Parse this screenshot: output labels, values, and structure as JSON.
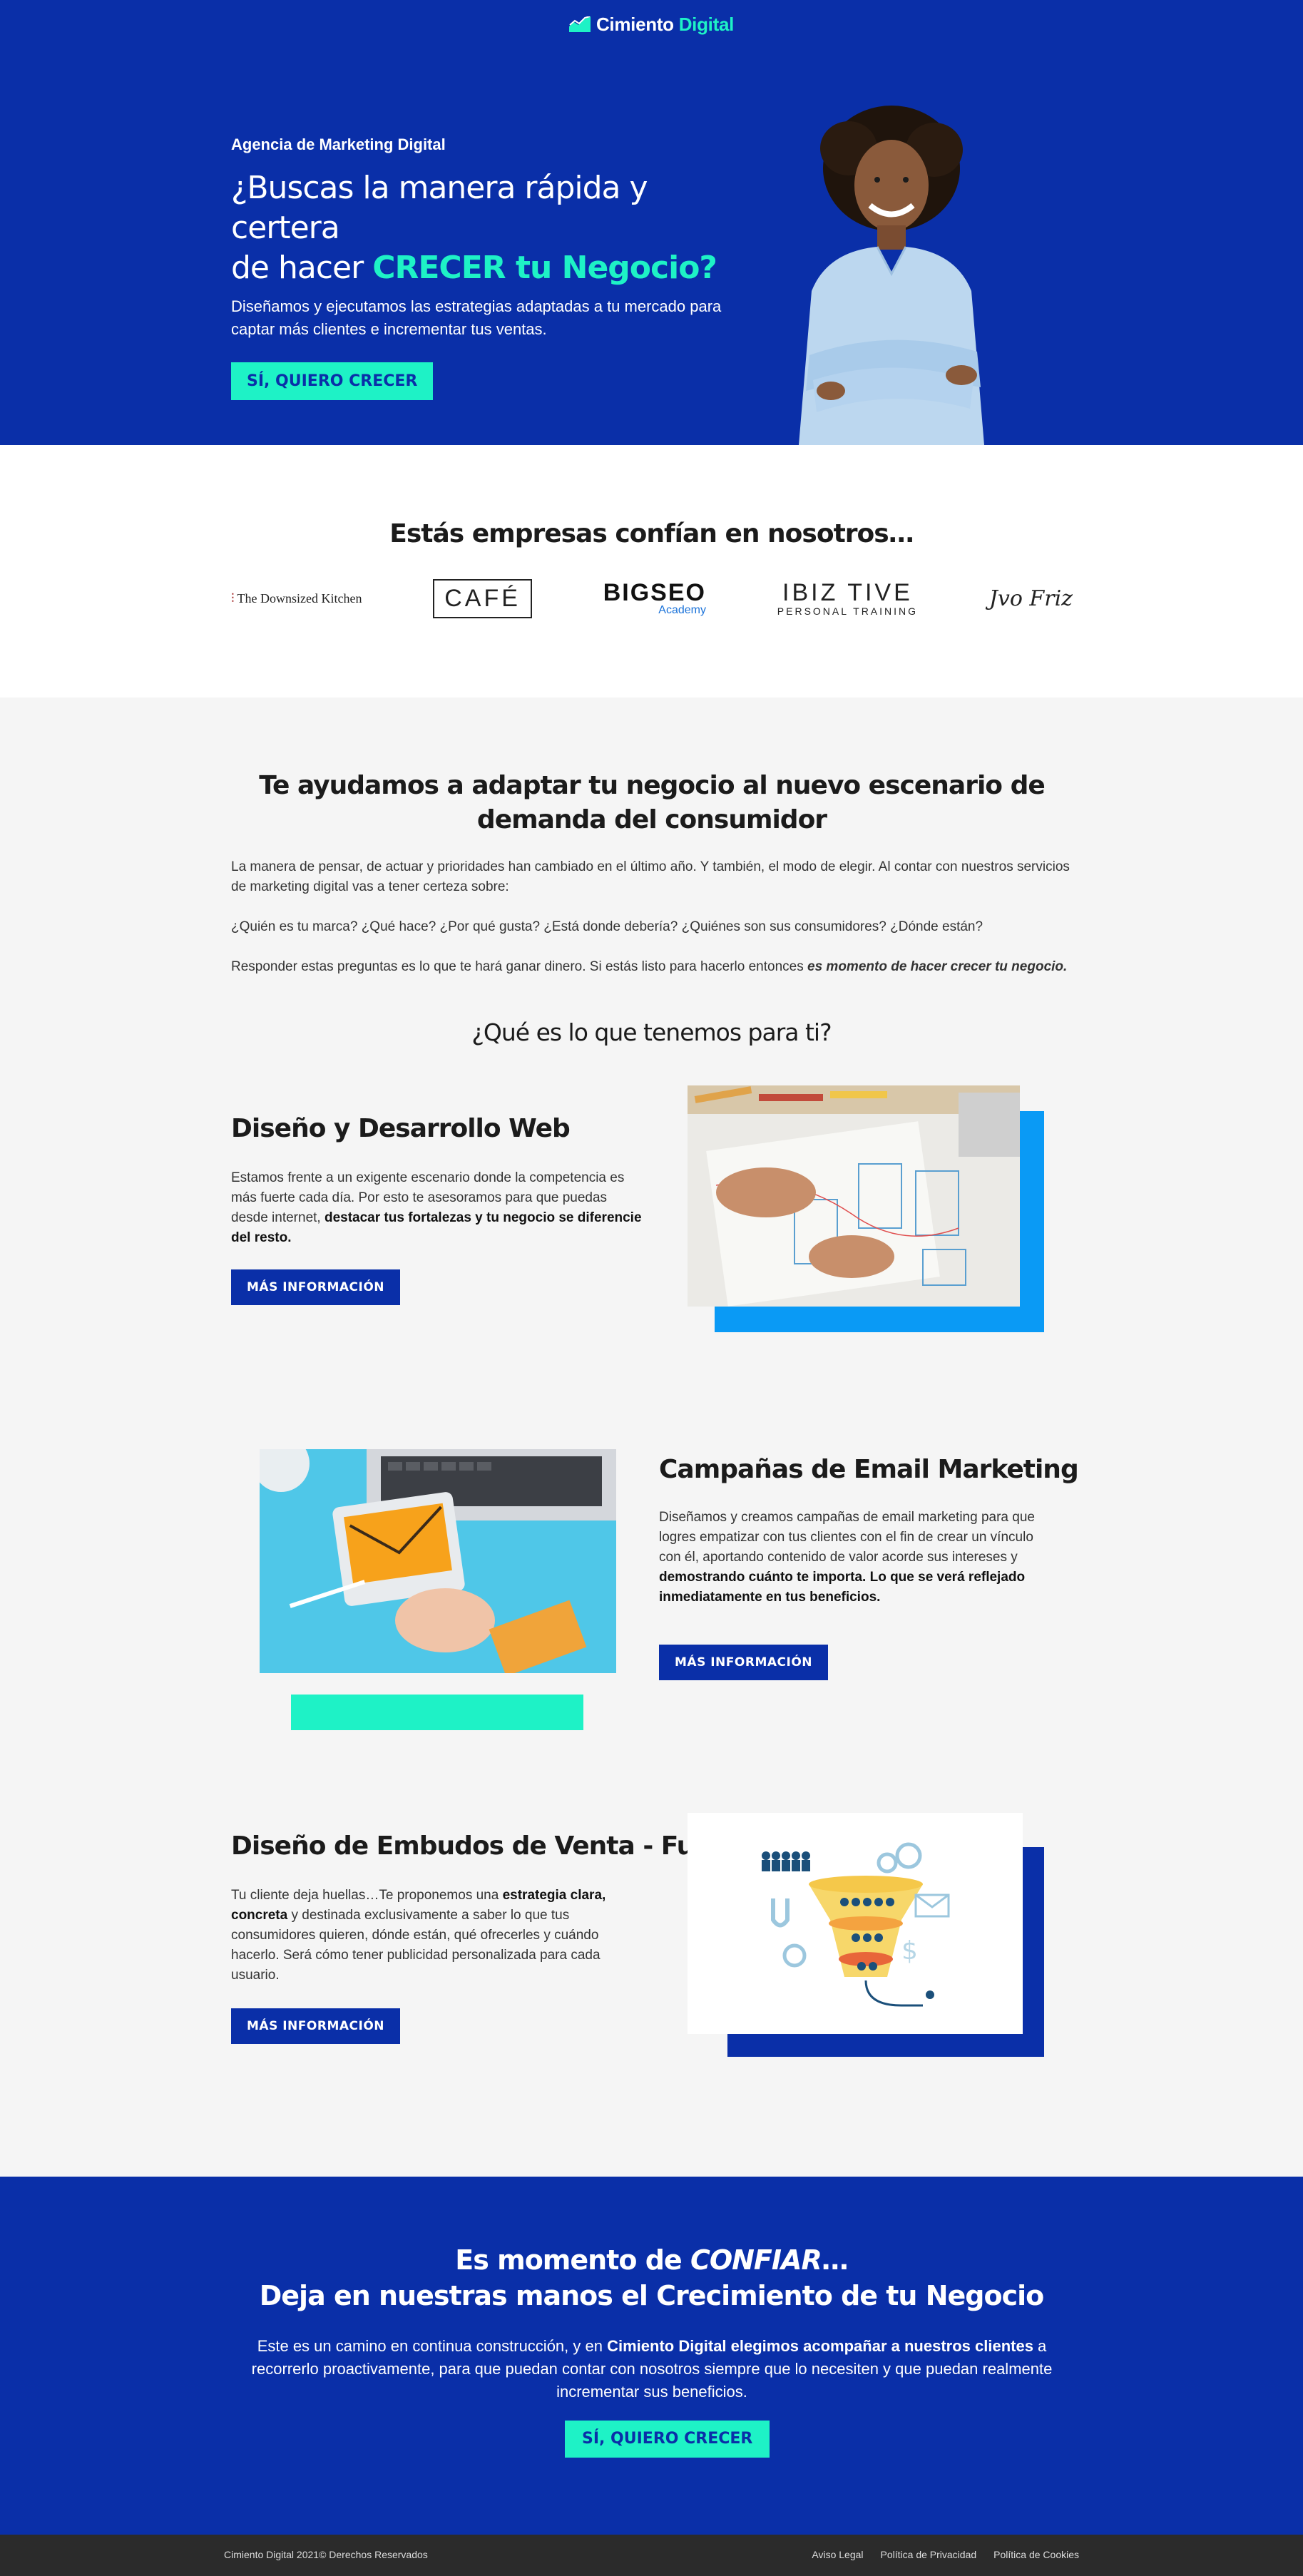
{
  "header": {
    "logo_part1": "Cimiento",
    "logo_part2": "Digital"
  },
  "hero": {
    "eyebrow": "Agencia de Marketing Digital",
    "title_line1": "¿Buscas la manera rápida y certera",
    "title_line2_prefix": "de hacer ",
    "title_highlight": "CRECER tu Negocio?",
    "subtitle": "Diseñamos y ejecutamos las estrategias adaptadas a tu mercado para captar más clientes e incrementar tus ventas.",
    "cta_label": "SÍ, QUIERO CRECER"
  },
  "clients": {
    "title": "Estás empresas confían en nosotros…",
    "logos": [
      {
        "name": "The Downsized Kitchen"
      },
      {
        "name": "CAFÉ"
      },
      {
        "name": "BIGSEO",
        "sub": "Academy"
      },
      {
        "name": "IBIZ TIVE",
        "sub": "PERSONAL TRAINING"
      },
      {
        "name": "Jvo Friz"
      }
    ]
  },
  "intro": {
    "title": "Te ayudamos a adaptar tu negocio al nuevo escenario de demanda del consumidor",
    "p1": "La manera de pensar, de actuar y prioridades han cambiado en el último año. Y también, el modo de elegir. Al contar con nuestros servicios de marketing digital vas a tener certeza sobre:",
    "p2": "¿Quién es tu marca? ¿Qué hace? ¿Por qué gusta? ¿Está donde debería? ¿Quiénes son sus consumidores? ¿Dónde están?",
    "p3_prefix": "Responder estas preguntas es lo que te hará ganar dinero. Si estás listo para hacerlo entonces ",
    "p3_emphasis": "es momento de hacer crecer tu negocio.",
    "subheading": "¿Qué es lo que tenemos para ti?"
  },
  "services": [
    {
      "title": "Diseño y Desarrollo Web",
      "text": "Estamos frente a un exigente escenario donde la competencia es más fuerte cada día. Por esto te asesoramos para que puedas desde internet, ",
      "bold": "destacar tus fortalezas y tu negocio se diferencie del resto.",
      "button": "MÁS INFORMACIÓN"
    },
    {
      "title": "Campañas de Email Marketing",
      "text": "Diseñamos y creamos campañas de email marketing para que logres empatizar con tus clientes con el fin de crear un vínculo con él, aportando contenido de valor acorde sus intereses y ",
      "bold": "demostrando cuánto te importa. Lo que se verá reflejado inmediatamente en tus beneficios.",
      "button": "MÁS INFORMACIÓN"
    },
    {
      "title": "Diseño de Embudos de Venta - Funnels",
      "text_prefix": "Tu cliente deja huellas…Te proponemos una ",
      "bold": "estrategia clara, concreta",
      "text_suffix": " y destinada exclusivamente a saber lo que tus consumidores quieren, dónde están, qué ofrecerles y cuándo hacerlo. Será cómo tener publicidad personalizada para cada usuario.",
      "button": "MÁS INFORMACIÓN"
    }
  ],
  "cta": {
    "line1_prefix": "Es momento de ",
    "line1_emphasis": "CONFIAR",
    "line1_suffix": "…",
    "line2": "Deja en nuestras manos el Crecimiento de tu Negocio",
    "p_prefix": "Este es un camino en continua construcción, y en ",
    "p_bold": "Cimiento Digital elegimos acompañar a nuestros clientes",
    "p_suffix": " a recorrerlo proactivamente, para que puedan contar con nosotros siempre que lo necesiten y que puedan realmente incrementar sus beneficios.",
    "button": "SÍ, QUIERO CRECER"
  },
  "footer": {
    "copyright": "Cimiento Digital 2021© Derechos Reservados",
    "links": [
      "Aviso Legal",
      "Política de Privacidad",
      "Política de Cookies"
    ]
  },
  "colors": {
    "brand_blue": "#0a2fa8",
    "mint": "#1ef2c6",
    "light_blue": "#0a9af5",
    "page_grey": "#f5f5f5",
    "footer": "#2b2b2b"
  }
}
